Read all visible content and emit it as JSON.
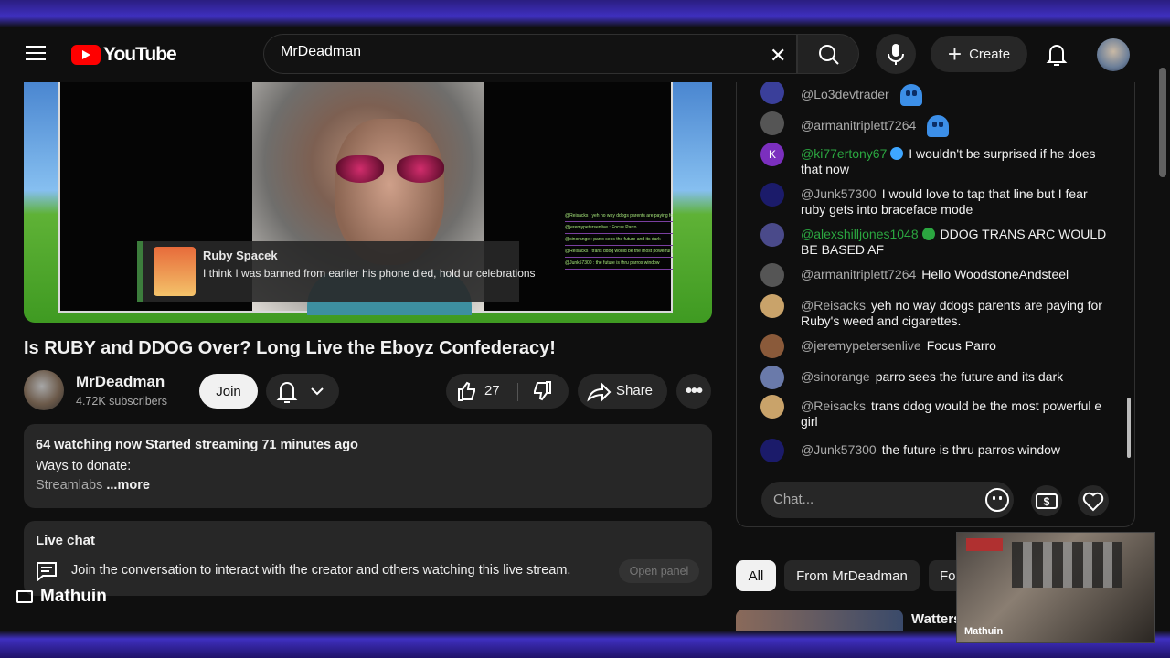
{
  "header": {
    "logo_text": "YouTube",
    "search_value": "MrDeadman",
    "create_label": "Create"
  },
  "video": {
    "overlay_name": "Ruby Spacek",
    "overlay_text": "I think I was banned from earlier his phone died, hold ur celebrations",
    "overlay_chatlog": [
      "@Reisacks : yeh no way ddogs parents are paying for Ruby's weed and cigarettes.",
      "@jeremypetersenlive : Focus Parro",
      "@sinorange : parro sees the future and its dark",
      "@Reisacks : trans ddog would be the most powerful girl",
      "@Junk57300 : the future is thru parros window"
    ],
    "title": "Is RUBY and DDOG Over? Long Live the Eboyz Confederacy!"
  },
  "channel": {
    "name": "MrDeadman",
    "subscribers": "4.72K subscribers",
    "join_label": "Join"
  },
  "actions": {
    "like_count": "27",
    "share_label": "Share"
  },
  "description": {
    "meta": "64 watching now  Started streaming 71 minutes ago",
    "line1": "Ways to donate:",
    "line2_faded": "Streamlabs",
    "more_label": " ...more"
  },
  "livechat_box": {
    "title": "Live chat",
    "text": "Join the conversation to interact with the creator and others watching this live stream.",
    "open_label": "Open panel"
  },
  "streamer_label": "Mathuin",
  "chat": {
    "messages": [
      {
        "author": "@Lo3devtrader",
        "text": "",
        "emoji": true,
        "avatar_color": "#3a3f9a"
      },
      {
        "author": "@armanitriplett7264",
        "text": "",
        "emoji": true,
        "avatar_color": "#555555"
      },
      {
        "author": "@ki77ertony67",
        "text": "I wouldn't be surprised if he does that now",
        "green": true,
        "badge": "blue",
        "avatar_color": "#7b2fbe",
        "initial": "K"
      },
      {
        "author": "@Junk57300",
        "text": "I would love to tap that line but I fear ruby gets into braceface mode",
        "avatar_color": "#1b1b6a"
      },
      {
        "author": "@alexshilljones1048",
        "text": "DDOG TRANS ARC WOULD BE BASED AF",
        "green": true,
        "badge": "green",
        "avatar_color": "#4a4a8a"
      },
      {
        "author": "@armanitriplett7264",
        "text": "Hello WoodstoneAndsteel",
        "avatar_color": "#555555"
      },
      {
        "author": "@Reisacks",
        "text": "yeh no way ddogs parents are paying for Ruby's weed and cigarettes.",
        "avatar_color": "#c9a36a"
      },
      {
        "author": "@jeremypetersenlive",
        "text": "Focus Parro",
        "avatar_color": "#8a5a3a"
      },
      {
        "author": "@sinorange",
        "text": "parro sees the future and its dark",
        "avatar_color": "#6a7aaa"
      },
      {
        "author": "@Reisacks",
        "text": "trans ddog would be the most powerful e girl",
        "avatar_color": "#c9a36a"
      },
      {
        "author": "@Junk57300",
        "text": "the future is thru parros window",
        "avatar_color": "#1b1b6a"
      }
    ],
    "input_placeholder": "Chat..."
  },
  "chips": [
    "All",
    "From MrDeadman",
    "Fo"
  ],
  "recommendation": {
    "title": "Watters"
  },
  "webcam_label": "Mathuin"
}
